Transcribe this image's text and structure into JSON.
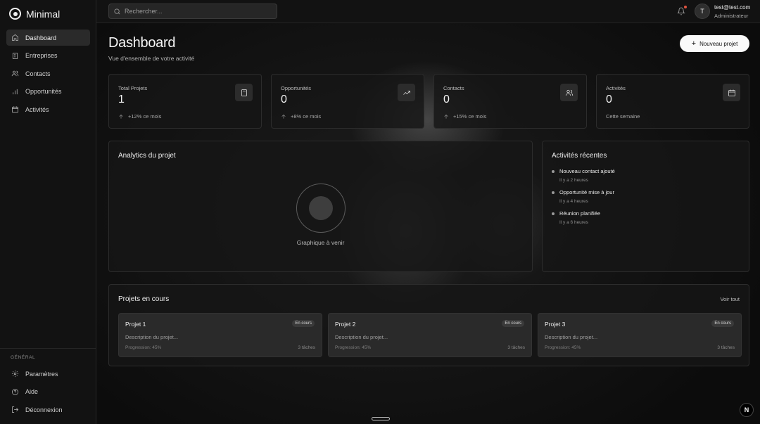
{
  "app": {
    "name": "Minimal"
  },
  "sidebar": {
    "items": [
      {
        "label": "Dashboard",
        "icon": "home-icon",
        "active": true
      },
      {
        "label": "Entreprises",
        "icon": "building-icon"
      },
      {
        "label": "Contacts",
        "icon": "users-icon"
      },
      {
        "label": "Opportunités",
        "icon": "bar-chart-icon"
      },
      {
        "label": "Activités",
        "icon": "calendar-icon"
      }
    ],
    "section_label": "GÉNÉRAL",
    "bottom_items": [
      {
        "label": "Paramètres",
        "icon": "gear-icon"
      },
      {
        "label": "Aide",
        "icon": "help-icon"
      },
      {
        "label": "Déconnexion",
        "icon": "logout-icon"
      }
    ]
  },
  "topbar": {
    "search_placeholder": "Rechercher...",
    "avatar_initial": "T",
    "user_email": "test@test.com",
    "user_role": "Administrateur"
  },
  "header": {
    "title": "Dashboard",
    "subtitle": "Vue d'ensemble de votre activité",
    "new_button": "Nouveau projet"
  },
  "stats": [
    {
      "label": "Total Projets",
      "value": "1",
      "trend": "+12% ce mois",
      "icon": "calculator-icon"
    },
    {
      "label": "Opportunités",
      "value": "0",
      "trend": "+8% ce mois",
      "icon": "trending-up-icon"
    },
    {
      "label": "Contacts",
      "value": "0",
      "trend": "+15% ce mois",
      "icon": "users-icon"
    },
    {
      "label": "Activités",
      "value": "0",
      "trend": "Cette semaine",
      "icon": "calendar-icon"
    }
  ],
  "analytics": {
    "title": "Analytics du projet",
    "placeholder": "Graphique à venir"
  },
  "recent": {
    "title": "Activités récentes",
    "items": [
      {
        "title": "Nouveau contact ajouté",
        "time": "Il y a 2 heures"
      },
      {
        "title": "Opportunité mise à jour",
        "time": "Il y a 4 heures"
      },
      {
        "title": "Réunion planifiée",
        "time": "Il y a 6 heures"
      }
    ]
  },
  "projects": {
    "title": "Projets en cours",
    "see_all": "Voir tout",
    "items": [
      {
        "name": "Projet 1",
        "status": "En cours",
        "description": "Description du projet...",
        "progress": "Progression: 45%",
        "tasks": "3 tâches"
      },
      {
        "name": "Projet 2",
        "status": "En cours",
        "description": "Description du projet...",
        "progress": "Progression: 45%",
        "tasks": "3 tâches"
      },
      {
        "name": "Projet 3",
        "status": "En cours",
        "description": "Description du projet...",
        "progress": "Progression: 45%",
        "tasks": "3 tâches"
      }
    ]
  },
  "corner_badge": "N"
}
